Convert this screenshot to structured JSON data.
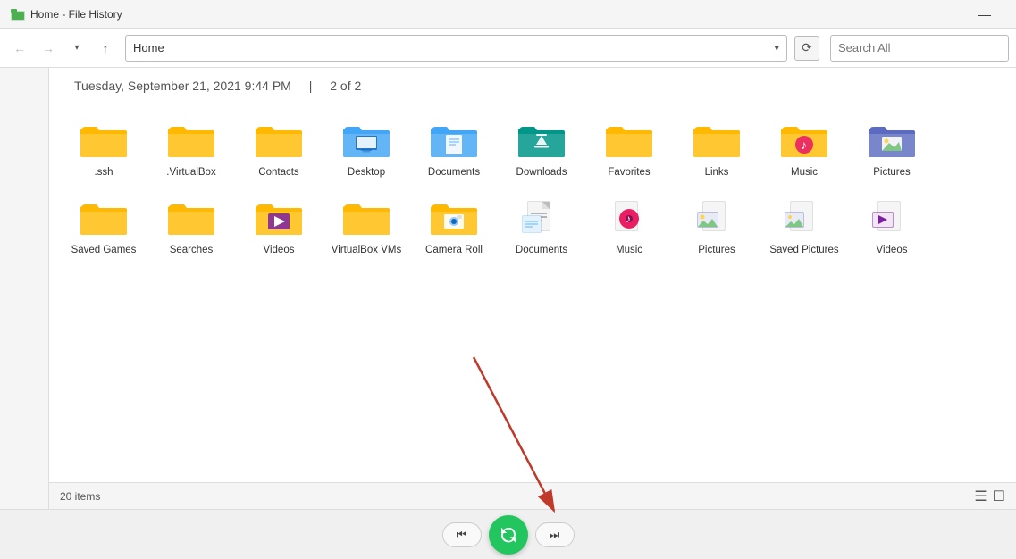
{
  "titleBar": {
    "title": "Home - File History",
    "minimizeLabel": "—"
  },
  "navBar": {
    "backLabel": "←",
    "forwardLabel": "→",
    "upLabel": "↑",
    "addressValue": "Home",
    "addressPlaceholder": "Home",
    "refreshLabel": "⟳",
    "searchPlaceholder": "Search All"
  },
  "dateHeader": {
    "dateText": "Tuesday, September 21, 2021 9:44 PM",
    "separator": "|",
    "pageInfo": "2 of 2"
  },
  "files": [
    {
      "id": 1,
      "name": ".ssh",
      "type": "folder-plain"
    },
    {
      "id": 2,
      "name": ".VirtualBox",
      "type": "folder-plain"
    },
    {
      "id": 3,
      "name": "Contacts",
      "type": "folder-plain"
    },
    {
      "id": 4,
      "name": "Desktop",
      "type": "folder-desktop"
    },
    {
      "id": 5,
      "name": "Documents",
      "type": "folder-documents"
    },
    {
      "id": 6,
      "name": "Downloads",
      "type": "folder-downloads"
    },
    {
      "id": 7,
      "name": "Favorites",
      "type": "folder-plain"
    },
    {
      "id": 8,
      "name": "Links",
      "type": "folder-plain"
    },
    {
      "id": 9,
      "name": "Music",
      "type": "folder-music"
    },
    {
      "id": 10,
      "name": "Pictures",
      "type": "folder-pictures"
    },
    {
      "id": 11,
      "name": "Saved Games",
      "type": "folder-plain"
    },
    {
      "id": 12,
      "name": "Searches",
      "type": "folder-plain"
    },
    {
      "id": 13,
      "name": "Videos",
      "type": "folder-videos"
    },
    {
      "id": 14,
      "name": "VirtualBox VMs",
      "type": "folder-plain"
    },
    {
      "id": 15,
      "name": "Camera Roll",
      "type": "folder-cameraroll"
    },
    {
      "id": 16,
      "name": "Documents",
      "type": "folder-documents-file"
    },
    {
      "id": 17,
      "name": "Music",
      "type": "folder-music-file"
    },
    {
      "id": 18,
      "name": "Pictures",
      "type": "folder-pictures-file"
    },
    {
      "id": 19,
      "name": "Saved Pictures",
      "type": "folder-savedpics"
    },
    {
      "id": 20,
      "name": "Videos",
      "type": "folder-videos-file"
    }
  ],
  "statusBar": {
    "itemCount": "20 items",
    "viewListLabel": "☰",
    "viewGridLabel": "☐"
  },
  "playback": {
    "prevLabel": "⏮",
    "playLabel": "↺",
    "nextLabel": "⏭"
  }
}
